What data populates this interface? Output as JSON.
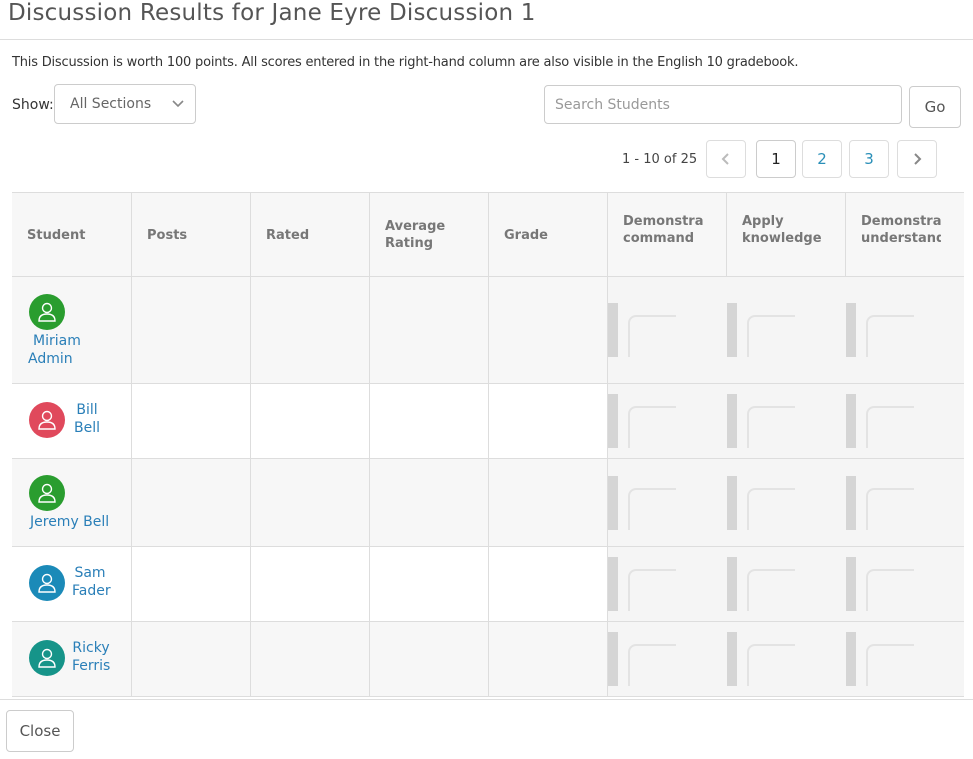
{
  "dialog": {
    "title": "Discussion Results for Jane Eyre Discussion 1",
    "info": "This Discussion is worth 100 points. All scores entered in the right-hand column are also visible in the English 10 gradebook."
  },
  "filters": {
    "show_label": "Show:",
    "section_value": "All Sections",
    "search_placeholder": "Search Students",
    "go_label": "Go"
  },
  "pagination": {
    "range": "1 - 10 of 25",
    "pages": [
      "1",
      "2",
      "3"
    ],
    "current": "1"
  },
  "table": {
    "columns": [
      "Student",
      "Posts",
      "Rated",
      "Average Rating",
      "Grade"
    ],
    "standards": [
      "Demonstrate command of the",
      "Apply knowledge of language",
      "Demonstrate understanding of figurative"
    ],
    "rows": [
      {
        "first": "Miriam",
        "last": "Admin",
        "color": "#2a9d2f"
      },
      {
        "first": "Bill",
        "last": "Bell",
        "color": "#e0495c"
      },
      {
        "first": "Jeremy Bell",
        "last": "",
        "color": "#2a9d2f"
      },
      {
        "first": "Sam",
        "last": "Fader",
        "color": "#1b8ab8"
      },
      {
        "first": "Ricky",
        "last": "Ferris",
        "color": "#169489"
      }
    ]
  },
  "footer": {
    "close_label": "Close"
  }
}
